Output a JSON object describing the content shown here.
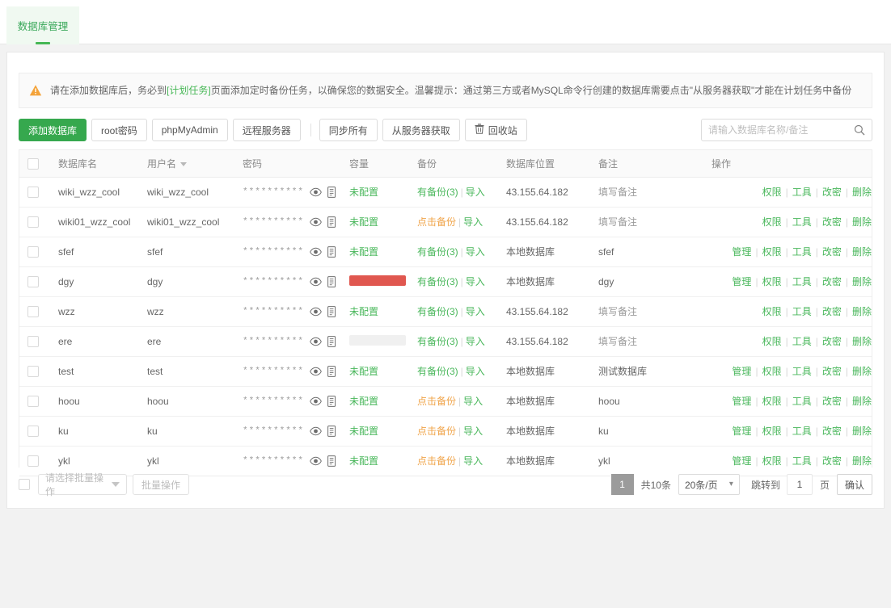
{
  "tab": {
    "label": "数据库管理"
  },
  "warning": {
    "icon": "warning-triangle-icon",
    "text_before": "请在添加数据库后，务必到",
    "link": "[计划任务]",
    "text_after": "页面添加定时备份任务，以确保您的数据安全。温馨提示：通过第三方或者MySQL命令行创建的数据库需要点击\"从服务器获取\"才能在计划任务中备份"
  },
  "toolbar": {
    "add_db": "添加数据库",
    "root_pwd": "root密码",
    "phpmyadmin": "phpMyAdmin",
    "remote_server": "远程服务器",
    "sync_all": "同步所有",
    "fetch_from_server": "从服务器获取",
    "recycle_bin": "回收站"
  },
  "search": {
    "placeholder": "请输入数据库名称/备注",
    "value": "",
    "icon": "search-icon"
  },
  "table": {
    "headers": {
      "db_name": "数据库名",
      "user_name": "用户名",
      "password": "密码",
      "capacity": "容量",
      "backup": "备份",
      "location": "数据库位置",
      "note": "备注",
      "ops": "操作"
    },
    "password_mask": "**********",
    "backup_import_label": "导入",
    "ops_labels": {
      "manage": "管理",
      "permission": "权限",
      "tools": "工具",
      "change_pwd": "改密",
      "delete": "删除"
    },
    "rows": [
      {
        "db": "wiki_wzz_cool",
        "user": "wiki_wzz_cool",
        "cap_type": "text",
        "cap": "未配置",
        "cap_pct": 0,
        "backup": "有备份(3)",
        "backup_type": "has",
        "loc": "43.155.64.182",
        "note": "填写备注",
        "note_placeholder": true,
        "manage": false
      },
      {
        "db": "wiki01_wzz_cool",
        "user": "wiki01_wzz_cool",
        "cap_type": "text",
        "cap": "未配置",
        "cap_pct": 0,
        "backup": "点击备份",
        "backup_type": "click",
        "loc": "43.155.64.182",
        "note": "填写备注",
        "note_placeholder": true,
        "manage": false
      },
      {
        "db": "sfef",
        "user": "sfef",
        "cap_type": "text",
        "cap": "未配置",
        "cap_pct": 0,
        "backup": "有备份(3)",
        "backup_type": "has",
        "loc": "本地数据库",
        "note": "sfef",
        "note_placeholder": false,
        "manage": true
      },
      {
        "db": "dgy",
        "user": "dgy",
        "cap_type": "bar",
        "cap": "",
        "cap_pct": 100,
        "backup": "有备份(3)",
        "backup_type": "has",
        "loc": "本地数据库",
        "note": "dgy",
        "note_placeholder": false,
        "manage": true
      },
      {
        "db": "wzz",
        "user": "wzz",
        "cap_type": "text",
        "cap": "未配置",
        "cap_pct": 0,
        "backup": "有备份(3)",
        "backup_type": "has",
        "loc": "43.155.64.182",
        "note": "填写备注",
        "note_placeholder": true,
        "manage": false
      },
      {
        "db": "ere",
        "user": "ere",
        "cap_type": "bar",
        "cap": "",
        "cap_pct": 0,
        "backup": "有备份(3)",
        "backup_type": "has",
        "loc": "43.155.64.182",
        "note": "填写备注",
        "note_placeholder": true,
        "manage": false
      },
      {
        "db": "test",
        "user": "test",
        "cap_type": "text",
        "cap": "未配置",
        "cap_pct": 0,
        "backup": "有备份(3)",
        "backup_type": "has",
        "loc": "本地数据库",
        "note": "测试数据库",
        "note_placeholder": false,
        "manage": true
      },
      {
        "db": "hoou",
        "user": "hoou",
        "cap_type": "text",
        "cap": "未配置",
        "cap_pct": 0,
        "backup": "点击备份",
        "backup_type": "click",
        "loc": "本地数据库",
        "note": "hoou",
        "note_placeholder": false,
        "manage": true
      },
      {
        "db": "ku",
        "user": "ku",
        "cap_type": "text",
        "cap": "未配置",
        "cap_pct": 0,
        "backup": "点击备份",
        "backup_type": "click",
        "loc": "本地数据库",
        "note": "ku",
        "note_placeholder": false,
        "manage": true
      },
      {
        "db": "ykl",
        "user": "ykl",
        "cap_type": "text",
        "cap": "未配置",
        "cap_pct": 0,
        "backup": "点击备份",
        "backup_type": "click",
        "loc": "本地数据库",
        "note": "ykl",
        "note_placeholder": false,
        "manage": true
      }
    ]
  },
  "footer": {
    "batch_select_placeholder": "请选择批量操作",
    "batch_button": "批量操作",
    "page_current": "1",
    "total_text": "共10条",
    "page_size": "20条/页",
    "jump_label": "跳转到",
    "jump_value": "1",
    "page_unit": "页",
    "confirm": "确认"
  },
  "colors": {
    "brand_green": "#36a84e",
    "link_green": "#49b75b",
    "warn_orange": "#f0a44a",
    "capacity_red": "#e0574f"
  }
}
